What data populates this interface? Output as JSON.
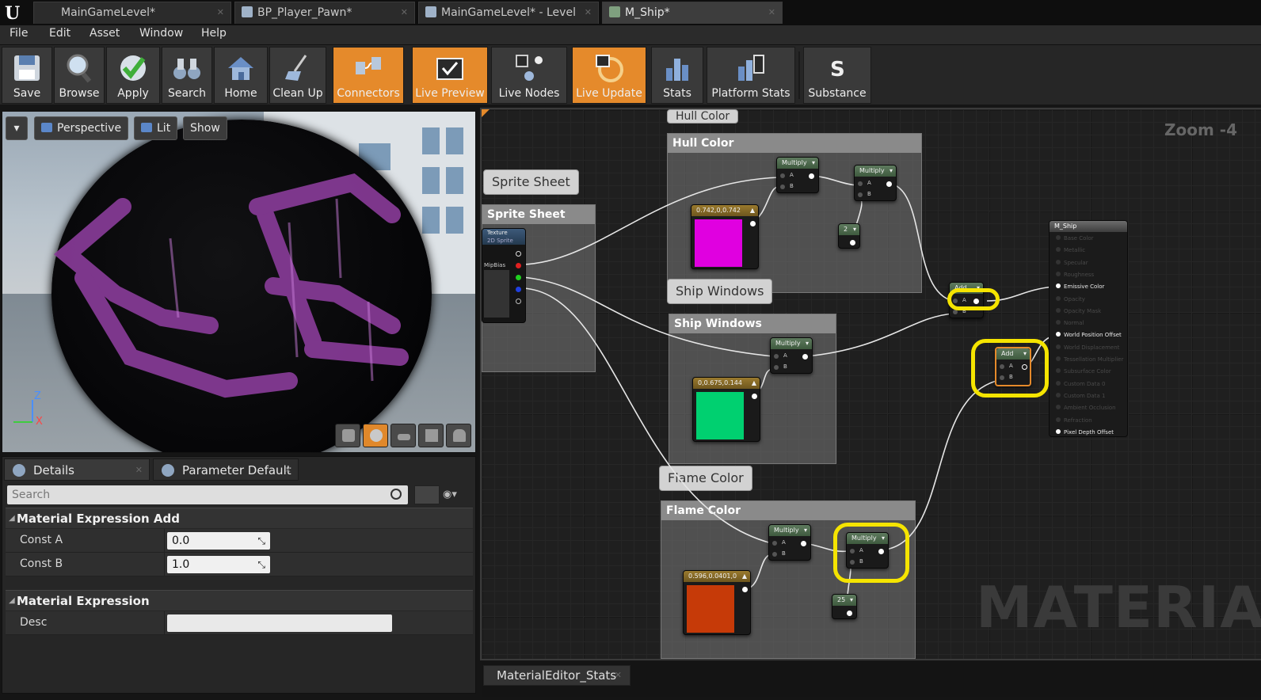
{
  "tabs": [
    {
      "label": "MainGameLevel*"
    },
    {
      "label": "BP_Player_Pawn*"
    },
    {
      "label": "MainGameLevel* - Level"
    },
    {
      "label": "M_Ship*"
    }
  ],
  "menu": [
    "File",
    "Edit",
    "Asset",
    "Window",
    "Help"
  ],
  "toolbar": {
    "buttons": [
      {
        "label": "Save",
        "icon": "save-icon"
      },
      {
        "label": "Browse",
        "icon": "browse-icon"
      },
      {
        "label": "Apply",
        "icon": "apply-check-icon"
      },
      {
        "label": "Search",
        "icon": "binoculars-icon"
      },
      {
        "label": "Home",
        "icon": "home-icon"
      },
      {
        "label": "Clean Up",
        "icon": "broom-icon"
      },
      {
        "label": "Connectors",
        "icon": "connectors-icon",
        "active": true
      },
      {
        "label": "Live Preview",
        "icon": "live-preview-icon",
        "active": true
      },
      {
        "label": "Live Nodes",
        "icon": "live-nodes-icon"
      },
      {
        "label": "Live Update",
        "icon": "live-update-icon",
        "active": true
      },
      {
        "label": "Stats",
        "icon": "stats-icon"
      },
      {
        "label": "Platform Stats",
        "icon": "platform-stats-icon"
      },
      {
        "label": "Substance",
        "icon": "substance-icon"
      }
    ],
    "active_color": "#e58a2b"
  },
  "viewport": {
    "perspective": "Perspective",
    "lit": "Lit",
    "show": "Show",
    "axis_z": "Z",
    "axis_x": "X"
  },
  "details": {
    "tab_details": "Details",
    "tab_params": "Parameter Default",
    "search_placeholder": "Search",
    "section1": "Material Expression Add",
    "const_a_label": "Const A",
    "const_a_value": "0.0",
    "const_b_label": "Const B",
    "const_b_value": "1.0",
    "section2": "Material Expression",
    "desc_label": "Desc"
  },
  "graph": {
    "zoom": "Zoom -4",
    "watermark": "MATERIAL",
    "comments": {
      "hull_bubble": "Hull Color",
      "hull": "Hull Color",
      "sprite_bubble": "Sprite Sheet",
      "sprite": "Sprite Sheet",
      "windows_bubble": "Ship Windows",
      "windows": "Ship Windows",
      "flame_bubble": "Flame Color",
      "flame": "Flame Color"
    },
    "nodes": {
      "multiply": "Multiply",
      "add": "Add",
      "pin_a": "A",
      "pin_b": "B",
      "texture": "Texture",
      "texture_sub": "2D Sprite",
      "mip_bias": "MipBias",
      "hull_const": "0.742,0,0.742",
      "windows_const": "0,0.675,0.144",
      "flame_const": "0.596,0.0401,0",
      "scalar_2": "2",
      "scalar_25": "25",
      "hull_color": "#e000e0",
      "windows_color": "#00d070",
      "flame_color": "#c63a08",
      "highlight_color": "#f5e400"
    },
    "result": {
      "title": "M_Ship",
      "pins": [
        {
          "label": "Base Color",
          "live": false
        },
        {
          "label": "Metallic",
          "live": false
        },
        {
          "label": "Specular",
          "live": false
        },
        {
          "label": "Roughness",
          "live": false
        },
        {
          "label": "Emissive Color",
          "live": true
        },
        {
          "label": "Opacity",
          "live": false
        },
        {
          "label": "Opacity Mask",
          "live": false
        },
        {
          "label": "Normal",
          "live": false
        },
        {
          "label": "World Position Offset",
          "live": true
        },
        {
          "label": "World Displacement",
          "live": false
        },
        {
          "label": "Tessellation Multiplier",
          "live": false
        },
        {
          "label": "Subsurface Color",
          "live": false
        },
        {
          "label": "Custom Data 0",
          "live": false
        },
        {
          "label": "Custom Data 1",
          "live": false
        },
        {
          "label": "Ambient Occlusion",
          "live": false
        },
        {
          "label": "Refraction",
          "live": false
        },
        {
          "label": "Pixel Depth Offset",
          "live": true
        }
      ]
    }
  },
  "bottom": {
    "stats_tab": "MaterialEditor_Stats"
  }
}
